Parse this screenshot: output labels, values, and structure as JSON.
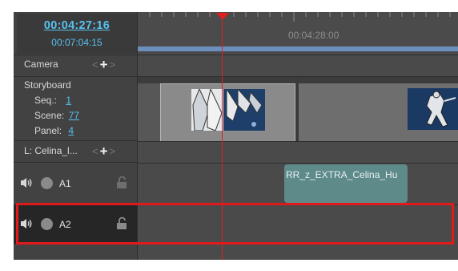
{
  "timecode": {
    "current": "00:04:27:16",
    "duration": "00:07:04:15"
  },
  "ruler": {
    "time_label": "00:04:28:00"
  },
  "camera_row": {
    "label": "Camera",
    "nav_prev": "<",
    "nav_add": "+",
    "nav_next": ">"
  },
  "storyboard_row": {
    "title": "Storyboard",
    "seq_label": "Seq.:",
    "seq_value": "1",
    "scene_label": "Scene:",
    "scene_value": "77",
    "panel_label": "Panel:",
    "panel_value": "4"
  },
  "layer_row": {
    "label": "L: Celina_l...",
    "nav_prev": "<",
    "nav_add": "+",
    "nav_next": ">"
  },
  "audio_tracks": [
    {
      "name": "A1"
    },
    {
      "name": "A2"
    }
  ],
  "audio_clip": {
    "label": "RR_z_EXTRA_Celina_Hu"
  },
  "icons": {
    "speaker": "speaker-icon",
    "lock": "unlock-icon",
    "mute": "circle-icon"
  },
  "colors": {
    "link": "#58c1f1",
    "playhead": "#e0201f",
    "highlight": "#e01a1a"
  }
}
